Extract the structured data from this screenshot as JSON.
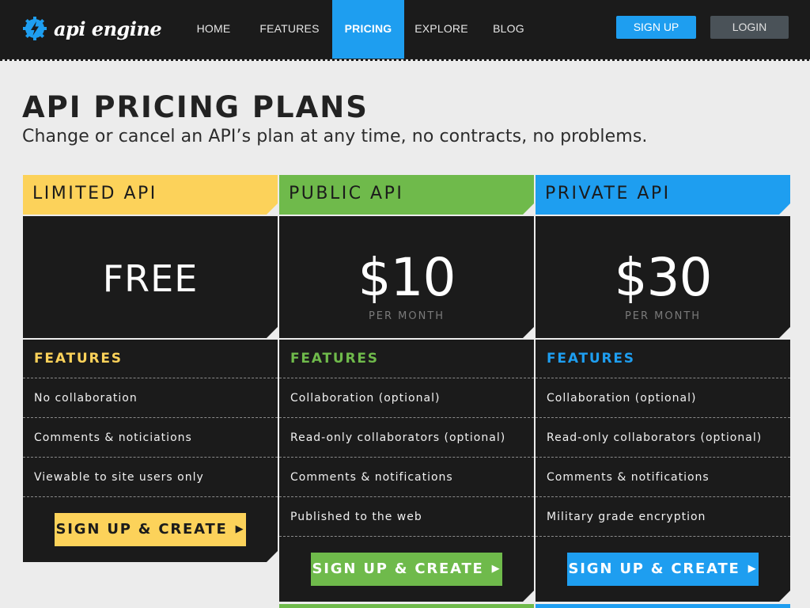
{
  "nav": {
    "logo_text": "api engine",
    "items": [
      {
        "label": "HOME"
      },
      {
        "label": "FEATURES"
      },
      {
        "label": "PRICING",
        "active": true
      },
      {
        "label": "EXPLORE"
      },
      {
        "label": "BLOG"
      }
    ],
    "signup_label": "SIGN UP",
    "login_label": "LOGIN"
  },
  "page": {
    "title": "API PRICING PLANS",
    "subtitle": "Change or cancel an API’s plan at any time, no contracts, no problems."
  },
  "colors": {
    "yellow": "#fcd25a",
    "green": "#6fba4b",
    "blue": "#1e9ef0",
    "dark": "#1b1b1b"
  },
  "plans": [
    {
      "name": "LIMITED API",
      "price": "FREE",
      "period": "",
      "features_title": "FEATURES",
      "features": [
        "No collaboration",
        "Comments & noticiations",
        "Viewable to site users only"
      ],
      "cta": "SIGN UP & CREATE"
    },
    {
      "name": "PUBLIC API",
      "price": "$10",
      "period": "PER MONTH",
      "features_title": "FEATURES",
      "features": [
        "Collaboration (optional)",
        "Read-only collaborators (optional)",
        "Comments & notifications",
        "Published to the web"
      ],
      "cta": "SIGN UP & CREATE"
    },
    {
      "name": "PRIVATE API",
      "price": "$30",
      "period": "PER MONTH",
      "features_title": "FEATURES",
      "features": [
        "Collaboration (optional)",
        "Read-only collaborators (optional)",
        "Comments & notifications",
        "Military grade encryption"
      ],
      "cta": "SIGN UP & CREATE"
    }
  ]
}
